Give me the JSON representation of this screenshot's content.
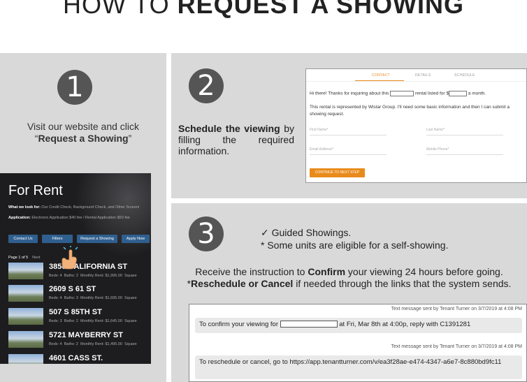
{
  "title": {
    "light": "HOW TO ",
    "bold": "REQUEST A SHOWING"
  },
  "step1": {
    "number": "1",
    "text_pre": "Visit our website and click “",
    "text_bold": "Request a Showing",
    "text_post": "”",
    "site": {
      "heading": "For Rent",
      "look_label": "What we look for:",
      "look_value": "Our Credit Check, Background Check, and Other Screeni",
      "app_label": "Application:",
      "app_value": "Electronic Application $40 fee / Rental Application $50 fee",
      "buttons": [
        "Contact Us",
        "Filters",
        "Request a Showing",
        "Apply Now"
      ],
      "page": "Page 1 of 5",
      "next": "Next",
      "listings": [
        {
          "address": "3856 CALIFORNIA ST",
          "beds_label": "Beds:",
          "beds": "4",
          "baths_label": "Baths:",
          "baths": "2",
          "rent_label": "Monthly Rent:",
          "rent": "$1,995.00",
          "square": "Square"
        },
        {
          "address": "2609 S 61 ST",
          "beds_label": "Beds:",
          "beds": "4",
          "baths_label": "Baths:",
          "baths": "3",
          "rent_label": "Monthly Rent:",
          "rent": "$1,695.00",
          "square": "Square"
        },
        {
          "address": "507 S 85TH ST",
          "beds_label": "Beds:",
          "beds": "3",
          "baths_label": "Baths:",
          "baths": "2",
          "rent_label": "Monthly Rent:",
          "rent": "$1,645.00",
          "square": "Square"
        },
        {
          "address": "5721 MAYBERRY ST",
          "beds_label": "Beds:",
          "beds": "4",
          "baths_label": "Baths:",
          "baths": "2",
          "rent_label": "Monthly Rent:",
          "rent": "$1,495.00",
          "square": "Square"
        },
        {
          "address": "4601 CASS ST.",
          "beds_label": "",
          "beds": "",
          "baths_label": "",
          "baths": "",
          "rent_label": "",
          "rent": "",
          "square": ""
        }
      ]
    }
  },
  "step2": {
    "number": "2",
    "text_bold": "Schedule the viewing",
    "text_rest": " by filling the required information.",
    "form": {
      "tabs": [
        "CONTACT",
        "DETAILS",
        "SCHEDULE"
      ],
      "line1_a": "Hi there! Thanks for inquiring about this ",
      "line1_b": " rental listed for $",
      "line1_c": " a month.",
      "line2": "This rental is represented by Wistar Group. I'll need some basic information and then I can submit a showing request.",
      "first_name": "First Name*",
      "last_name": "Last Name*",
      "email": "Email Address*",
      "phone": "Mobile Phone*",
      "continue_label": "CONTINUE TO NEXT STEP"
    }
  },
  "step3": {
    "number": "3",
    "guided": "✓ Guided Showings.",
    "self": "* Some units are eligible for a self-showing.",
    "receive_pre": "Receive the instruction to ",
    "receive_bold": "Confirm",
    "receive_post": " your viewing 24 hours before going.",
    "resched_pre": "*",
    "resched_bold": "Reschedule or Cancel",
    "resched_post": " if needed through the links that the system sends.",
    "sms": {
      "header1": "Text message sent by Tenant Turner on 3/7/2019 at 4:08 PM",
      "msg1_a": "To confirm your viewing for ",
      "msg1_b": " at Fri, Mar 8th at 4:00p, reply with C1391281",
      "header2": "Text message sent by Tenant Turner on 3/7/2019 at 4:08 PM",
      "msg2": "To reschedule or cancel, go to https://app.tenantturner.com/v/ea3f28ae-e474-4347-a6e7-8c880bd9fc11"
    }
  },
  "colors": {
    "panel": "#d9d9d9",
    "circle": "#555555",
    "accent": "#e98b1c",
    "site_button": "#2f5f8f"
  }
}
